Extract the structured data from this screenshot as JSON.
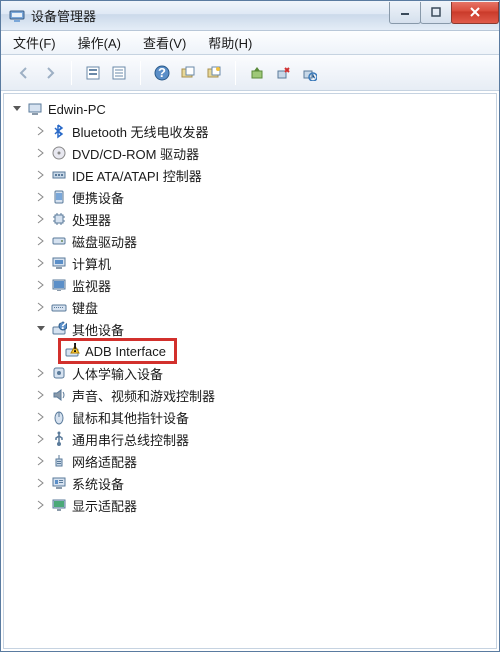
{
  "window": {
    "title": "设备管理器"
  },
  "menu": {
    "file": "文件(F)",
    "action": "操作(A)",
    "view": "查看(V)",
    "help": "帮助(H)"
  },
  "tree": {
    "root": "Edwin-PC",
    "items": [
      {
        "label": "Bluetooth 无线电收发器",
        "icon": "bluetooth"
      },
      {
        "label": "DVD/CD-ROM 驱动器",
        "icon": "cd"
      },
      {
        "label": "IDE ATA/ATAPI 控制器",
        "icon": "ide"
      },
      {
        "label": "便携设备",
        "icon": "portable"
      },
      {
        "label": "处理器",
        "icon": "cpu"
      },
      {
        "label": "磁盘驱动器",
        "icon": "disk"
      },
      {
        "label": "计算机",
        "icon": "computer"
      },
      {
        "label": "监视器",
        "icon": "monitor"
      },
      {
        "label": "键盘",
        "icon": "keyboard"
      }
    ],
    "other_devices": {
      "label": "其他设备",
      "child": "ADB Interface"
    },
    "items2": [
      {
        "label": "人体学输入设备",
        "icon": "hid"
      },
      {
        "label": "声音、视频和游戏控制器",
        "icon": "sound"
      },
      {
        "label": "鼠标和其他指针设备",
        "icon": "mouse"
      },
      {
        "label": "通用串行总线控制器",
        "icon": "usb"
      },
      {
        "label": "网络适配器",
        "icon": "network"
      },
      {
        "label": "系统设备",
        "icon": "system"
      },
      {
        "label": "显示适配器",
        "icon": "display"
      }
    ]
  }
}
